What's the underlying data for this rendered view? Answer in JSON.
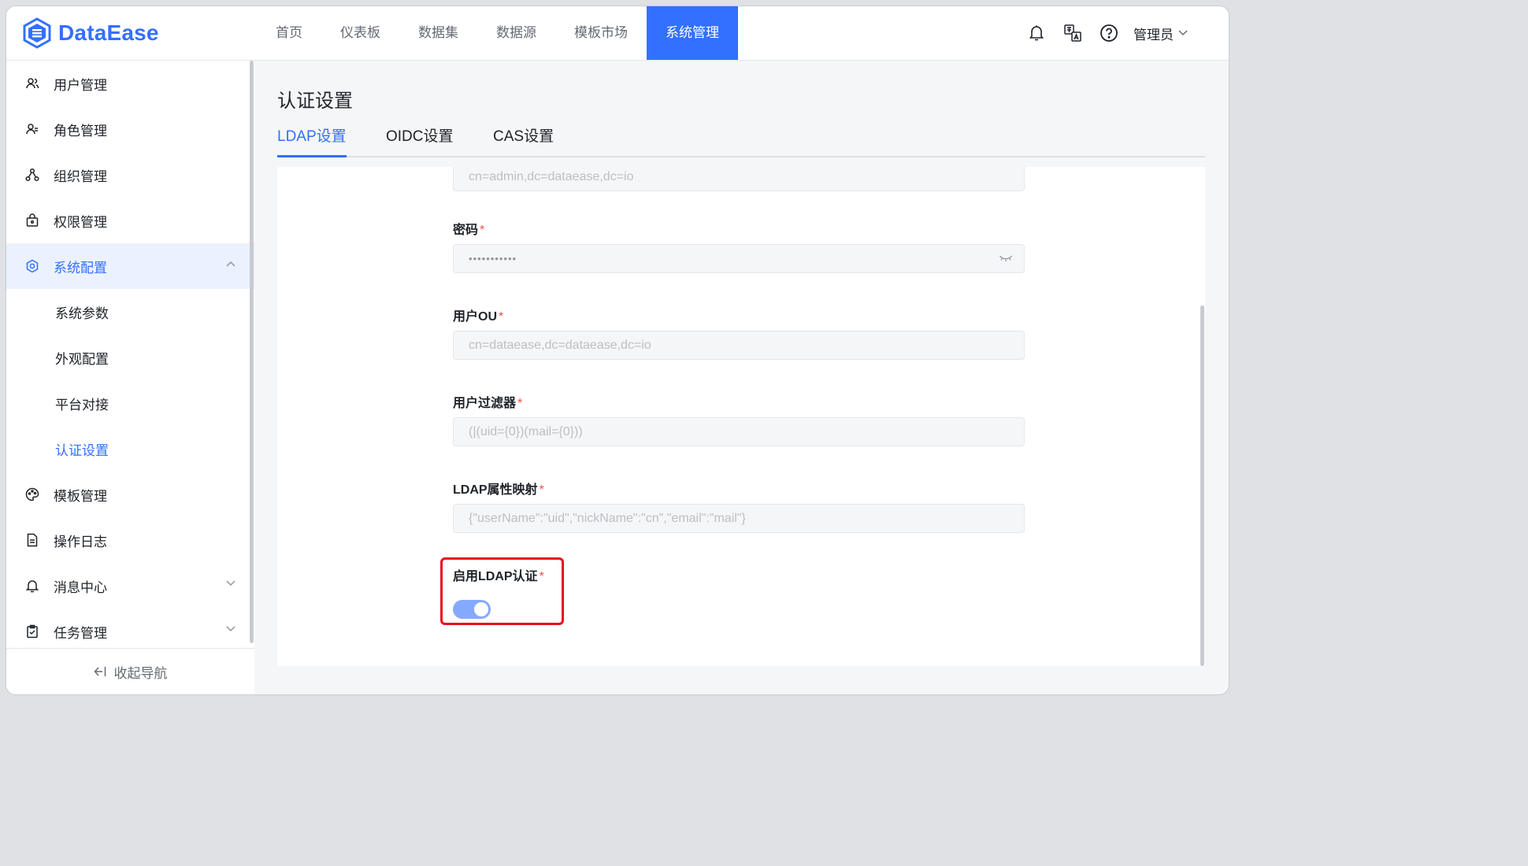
{
  "app": {
    "logo_text": "DataEase"
  },
  "topnav": {
    "items": [
      {
        "label": "首页"
      },
      {
        "label": "仪表板"
      },
      {
        "label": "数据集"
      },
      {
        "label": "数据源"
      },
      {
        "label": "模板市场"
      },
      {
        "label": "系统管理",
        "active": true
      }
    ]
  },
  "header": {
    "user_label": "管理员"
  },
  "sidebar": {
    "items": [
      {
        "label": "用户管理",
        "icon": "user-icon"
      },
      {
        "label": "角色管理",
        "icon": "role-icon"
      },
      {
        "label": "组织管理",
        "icon": "org-icon"
      },
      {
        "label": "权限管理",
        "icon": "lock-icon"
      },
      {
        "label": "系统配置",
        "icon": "gear-icon",
        "expanded": true
      },
      {
        "label": "模板管理",
        "icon": "palette-icon"
      },
      {
        "label": "操作日志",
        "icon": "log-icon"
      },
      {
        "label": "消息中心",
        "icon": "bell-icon"
      },
      {
        "label": "任务管理",
        "icon": "task-icon"
      }
    ],
    "sub_items": [
      {
        "label": "系统参数"
      },
      {
        "label": "外观配置"
      },
      {
        "label": "平台对接"
      },
      {
        "label": "认证设置",
        "active": true
      }
    ],
    "collapse_label": "收起导航"
  },
  "main": {
    "title": "认证设置",
    "tabs": [
      {
        "label": "LDAP设置",
        "active": true
      },
      {
        "label": "OIDC设置"
      },
      {
        "label": "CAS设置"
      }
    ],
    "form": {
      "admin_dn": {
        "placeholder": "cn=admin,dc=dataease,dc=io"
      },
      "password": {
        "label": "密码",
        "required_mark": "*",
        "value": "•••••••••••"
      },
      "user_ou": {
        "label": "用户OU",
        "required_mark": "*",
        "placeholder": "cn=dataease,dc=dataease,dc=io"
      },
      "user_filter": {
        "label": "用户过滤器",
        "required_mark": "*",
        "placeholder": "(|(uid={0})(mail={0}))"
      },
      "attr_mapping": {
        "label": "LDAP属性映射",
        "required_mark": "*",
        "placeholder": "{\"userName\":\"uid\",\"nickName\":\"cn\",\"email\":\"mail\"}"
      },
      "enable_ldap": {
        "label": "启用LDAP认证",
        "required_mark": "*",
        "enabled": true
      }
    }
  },
  "colors": {
    "accent": "#3370ff",
    "required": "#f54a45",
    "highlight": "#e8101c",
    "switch_on": "#85a9ff"
  }
}
